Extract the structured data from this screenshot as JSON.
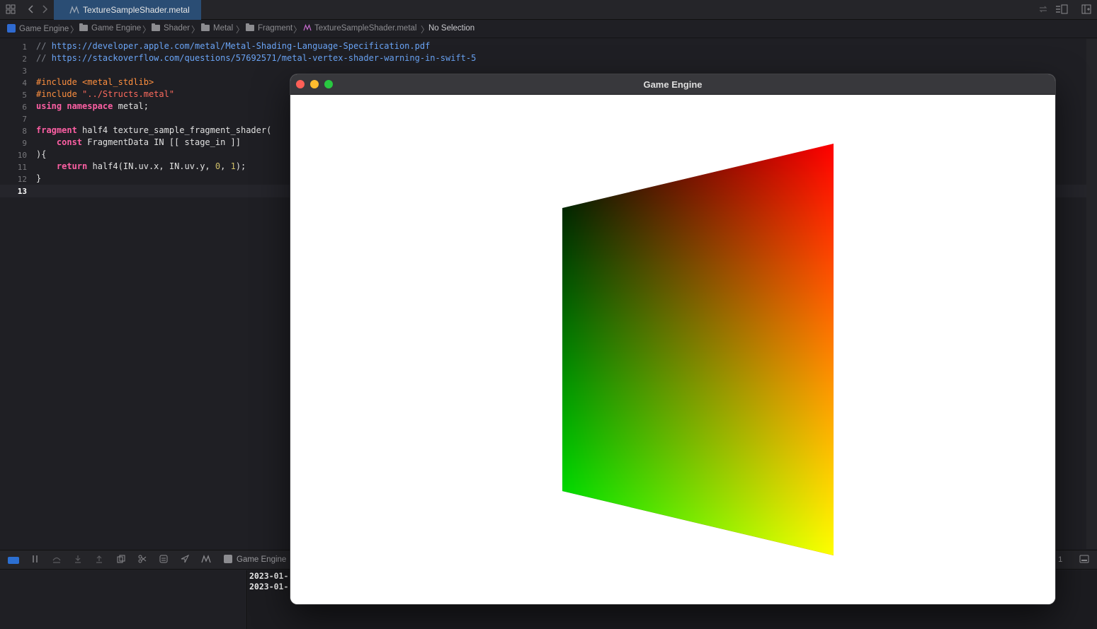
{
  "tabbar": {
    "active_tab": "TextureSampleShader.metal"
  },
  "breadcrumb": {
    "items": [
      "Game Engine",
      "Game Engine",
      "Shader",
      "Metal",
      "Fragment",
      "TextureSampleShader.metal",
      "No Selection"
    ]
  },
  "editor": {
    "line_numbers": [
      "1",
      "2",
      "3",
      "4",
      "5",
      "6",
      "7",
      "8",
      "9",
      "10",
      "11",
      "12",
      "13"
    ],
    "current_line": "13",
    "code": {
      "l1_prefix": "// ",
      "l1_url": "https://developer.apple.com/metal/Metal-Shading-Language-Specification.pdf",
      "l2_prefix": "// ",
      "l2_url": "https://stackoverflow.com/questions/57692571/metal-vertex-shader-warning-in-swift-5",
      "l4_directive": "#include <metal_stdlib>",
      "l5_directive": "#include ",
      "l5_string": "\"../Structs.metal\"",
      "l6_kw1": "using",
      "l6_kw2": "namespace",
      "l6_rest": " metal;",
      "l8_kw": "fragment",
      "l8_rest": " half4 texture_sample_fragment_shader(",
      "l9_kw": "const",
      "l9_rest": " FragmentData IN [[ stage_in ]]",
      "l10": "){",
      "l11_kw": "return",
      "l11_a": " half4(IN.uv.x, IN.uv.y, ",
      "l11_n1": "0",
      "l11_b": ", ",
      "l11_n2": "1",
      "l11_c": ");",
      "l12": "}"
    }
  },
  "debugbar": {
    "target": "Game Engine",
    "line_info": ": 1"
  },
  "console": {
    "lines": [
      "2023-01-",
      "2023-01-"
    ]
  },
  "window": {
    "title": "Game Engine",
    "quad_colors": {
      "top_left": "#000000",
      "top_right": "#ff0000",
      "bottom_left": "#00ff00",
      "bottom_right": "#ffff00"
    }
  },
  "colors": {
    "accent": "#2a4d74",
    "url": "#6aa4f5",
    "keyword": "#fc5fa3",
    "preprocessor": "#fd8f3f",
    "string": "#fc6a5d",
    "number": "#d0bf69"
  }
}
